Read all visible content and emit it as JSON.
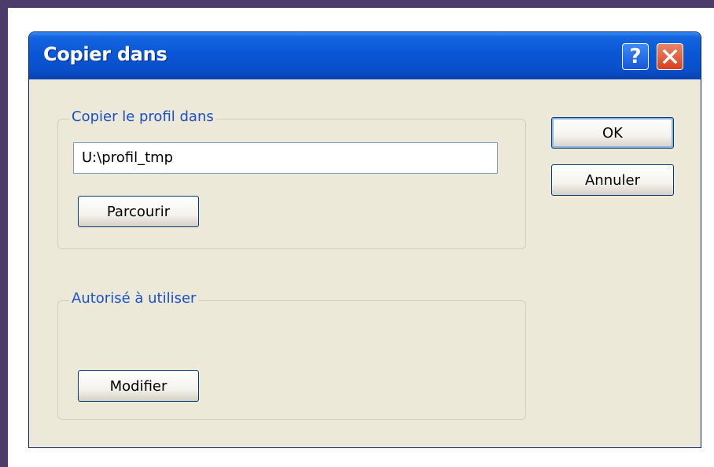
{
  "dialog": {
    "title": "Copier dans",
    "help_label": "?",
    "close_label": "✕"
  },
  "group_copy": {
    "legend": "Copier le profil dans",
    "path_value": "U:\\profil_tmp",
    "browse_label": "Parcourir"
  },
  "group_allowed": {
    "legend": "Autorisé à utiliser",
    "modify_label": "Modifier"
  },
  "buttons": {
    "ok_label": "OK",
    "cancel_label": "Annuler"
  },
  "colors": {
    "frame": "#4b3c6b",
    "title_bar": "#0a57d6",
    "dialog_bg": "#ece9d8",
    "legend_text": "#1a4fc8",
    "close_button": "#d8401c"
  }
}
